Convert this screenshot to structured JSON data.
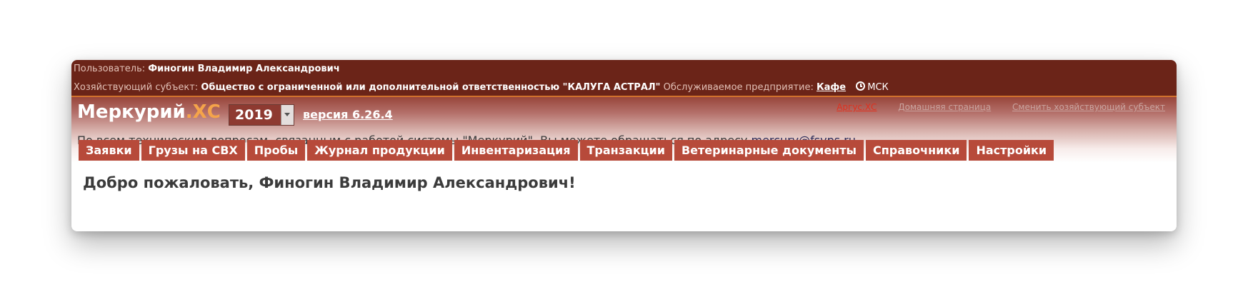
{
  "topbar": {
    "user_label": "Пользователь:",
    "user_name": "Финогин Владимир Александрович",
    "entity_label": "Хозяйствующий субъект:",
    "entity_name": "Общество с ограниченной или дополнительной ответственностью \"КАЛУГА АСТРАЛ\"",
    "enterprise_label": "Обслуживаемое предприятие:",
    "enterprise_name": "Кафе",
    "timezone": "МСК"
  },
  "header": {
    "logo_main": "Меркурий",
    "logo_accent": ".ХС",
    "year": "2019",
    "version": "версия 6.26.4",
    "links": {
      "argus": "Аргус.ХС",
      "home": "Домашняя страница",
      "change_entity": "Сменить хозяйствующий субъект"
    },
    "support_text": "По всем техническим вопросам, связанным с работой системы \"Меркурий\", Вы можете обращаться по адресу",
    "support_email": "mercury@fsvps.ru"
  },
  "menu": {
    "items": [
      {
        "label": "Заявки"
      },
      {
        "label": "Грузы на СВХ"
      },
      {
        "label": "Пробы"
      },
      {
        "label": "Журнал продукции"
      },
      {
        "label": "Инвентаризация"
      },
      {
        "label": "Транзакции"
      },
      {
        "label": "Ветеринарные документы"
      },
      {
        "label": "Справочники"
      },
      {
        "label": "Настройки"
      }
    ]
  },
  "main": {
    "welcome": "Добро пожаловать, Финогин Владимир Александрович!"
  },
  "colors": {
    "topbar": "#6b2418",
    "accent": "#f5a44a",
    "menu_item": "#b74a3a",
    "argus_link": "#e0301e"
  }
}
